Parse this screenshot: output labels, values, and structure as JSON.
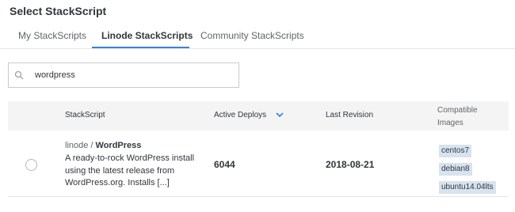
{
  "dialog": {
    "title": "Select StackScript"
  },
  "tabs": [
    {
      "label": "My StackScripts",
      "active": false
    },
    {
      "label": "Linode StackScripts",
      "active": true
    },
    {
      "label": "Community StackScripts",
      "active": false
    }
  ],
  "search": {
    "value": "wordpress",
    "icon": "search-icon"
  },
  "table": {
    "headers": {
      "stackscript": "StackScript",
      "active_deploys": "Active Deploys",
      "last_revision": "Last Revision",
      "compatible_images": "Compatible Images"
    },
    "sort_icon": "chevron-down-icon",
    "rows": [
      {
        "selected": false,
        "username": "linode",
        "separator": " / ",
        "label": "WordPress",
        "description": "A ready-to-rock WordPress install using the latest release from WordPress.org. Installs [...]",
        "active_deploys": "6044",
        "last_revision": "2018-08-21",
        "images": [
          "centos7",
          "debian8",
          "ubuntu14.04lts"
        ]
      }
    ]
  },
  "colors": {
    "accent": "#3683dc",
    "chip_bg": "#d7e3ef",
    "header_bg": "#f4f4f4"
  }
}
